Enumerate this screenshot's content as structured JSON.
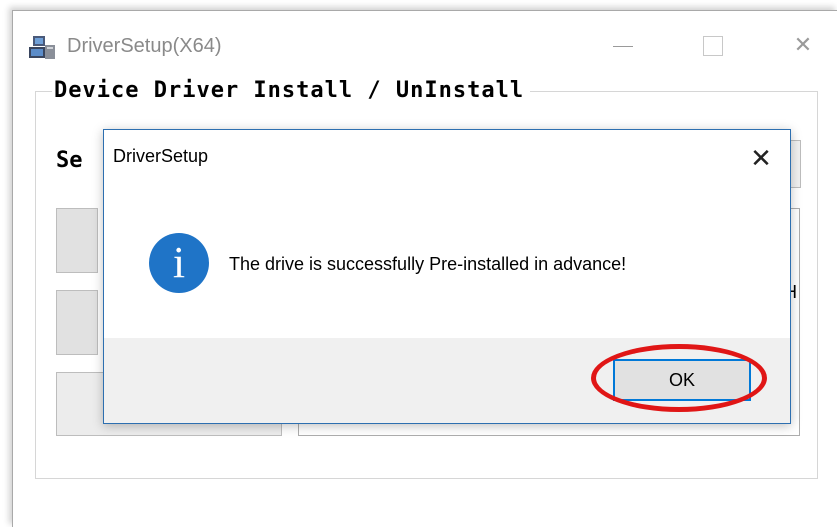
{
  "main_window": {
    "title": "DriverSetup(X64)",
    "controls": {
      "minimize": "—",
      "close": "✕"
    }
  },
  "background": {
    "group_title": "Device Driver Install / UnInstall",
    "select_label_partial": "Se",
    "edge_char": "H"
  },
  "dialog": {
    "title": "DriverSetup",
    "close": "✕",
    "icon_glyph": "i",
    "message": "The drive is successfully Pre-installed in advance!",
    "ok_label": "OK"
  },
  "colors": {
    "info_icon": "#1f74c7",
    "ok_focus_border": "#0078d7",
    "highlight_annotation": "#e01616"
  },
  "icons": [
    "app-icon",
    "minimize-icon",
    "maximize-icon",
    "close-icon",
    "info-icon"
  ]
}
